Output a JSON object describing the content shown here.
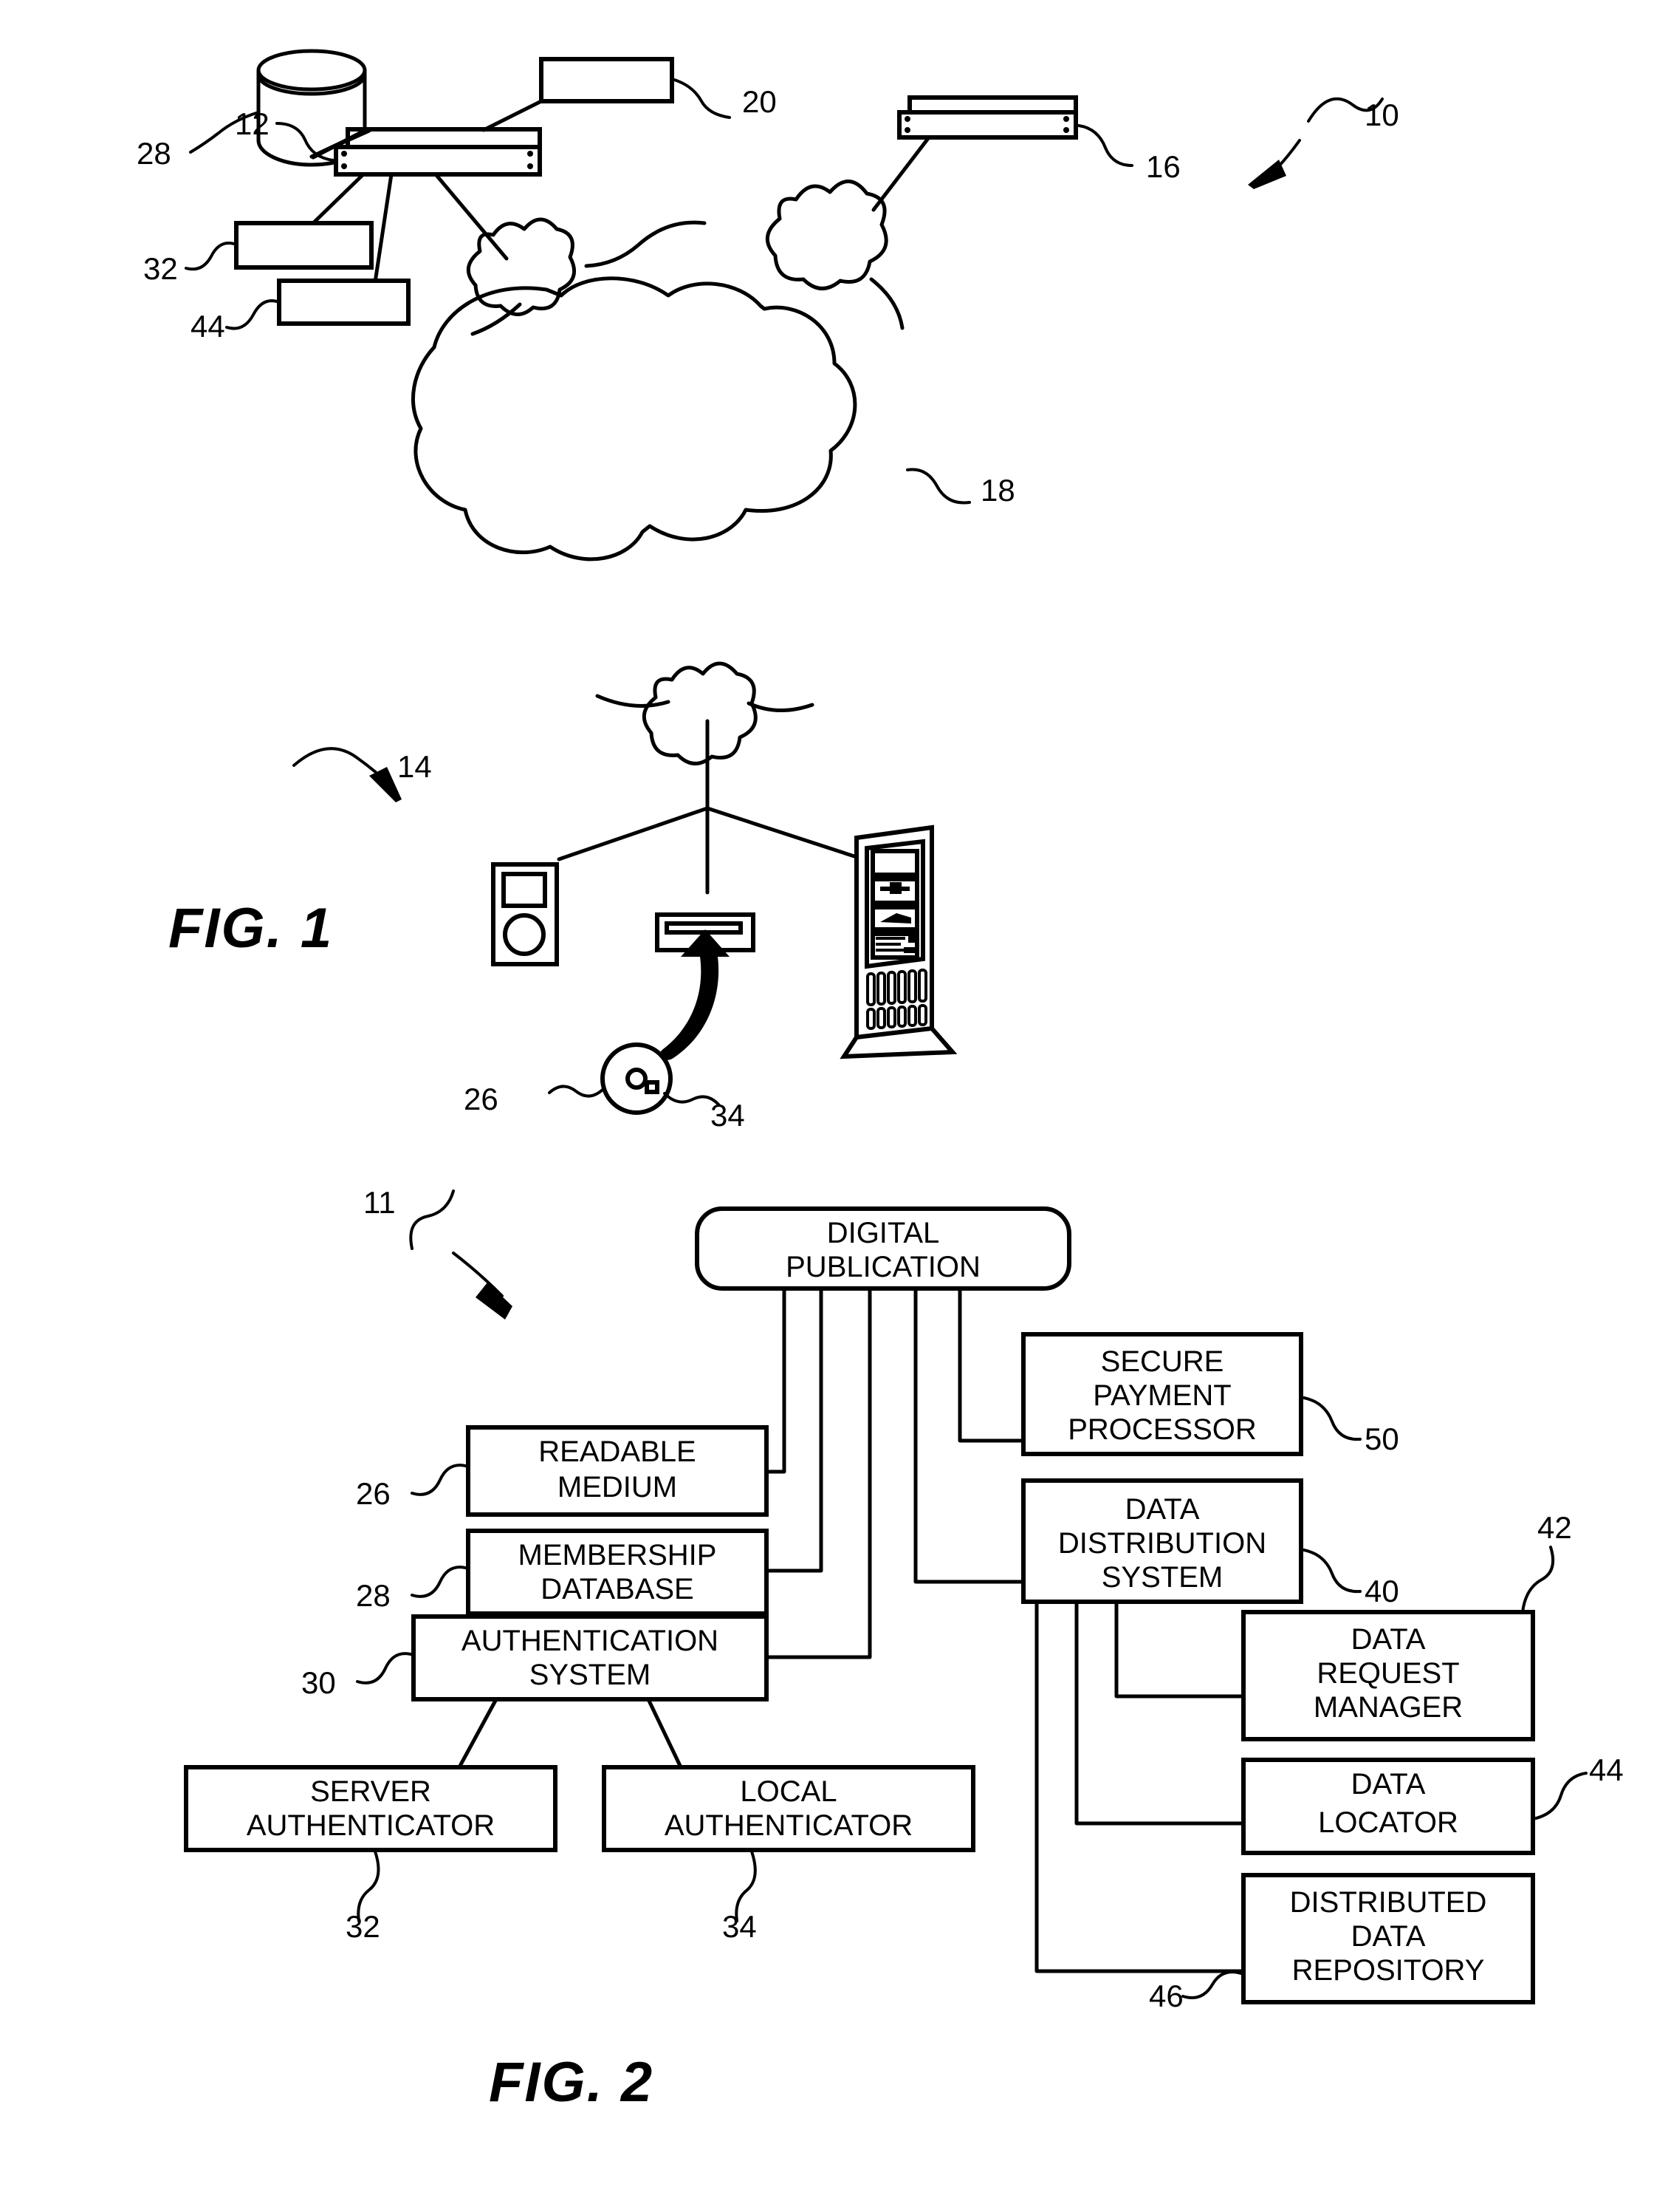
{
  "figures": [
    {
      "id": "fig1",
      "label": "FIG. 1",
      "overall_ref": "10",
      "reference_numbers": [
        {
          "id": "r28",
          "text": "28"
        },
        {
          "id": "r20",
          "text": "20"
        },
        {
          "id": "r12",
          "text": "12"
        },
        {
          "id": "r16",
          "text": "16"
        },
        {
          "id": "r10",
          "text": "10"
        },
        {
          "id": "r32",
          "text": "32"
        },
        {
          "id": "r18",
          "text": "18"
        },
        {
          "id": "r44",
          "text": "44"
        },
        {
          "id": "r14",
          "text": "14"
        },
        {
          "id": "r26",
          "text": "26"
        },
        {
          "id": "r34",
          "text": "34"
        }
      ],
      "components": [
        {
          "name": "database-cylinder",
          "ref": "28"
        },
        {
          "name": "blank-box-20",
          "ref": "20"
        },
        {
          "name": "server-rack-12",
          "ref": "12"
        },
        {
          "name": "server-rack-16",
          "ref": "16"
        },
        {
          "name": "blank-box-32",
          "ref": "32"
        },
        {
          "name": "blank-box-44",
          "ref": "44"
        },
        {
          "name": "network-cloud-18",
          "ref": "18"
        },
        {
          "name": "client-group-14",
          "ref": "14"
        },
        {
          "name": "optical-disc-26",
          "ref": "26"
        },
        {
          "name": "disc-drive-34",
          "ref": "34"
        },
        {
          "name": "handheld-device",
          "ref": ""
        },
        {
          "name": "tower-computer",
          "ref": ""
        }
      ]
    },
    {
      "id": "fig2",
      "label": "FIG. 2",
      "overall_ref": "11",
      "boxes": [
        {
          "id": "digital-publication",
          "lines": [
            "DIGITAL",
            "PUBLICATION"
          ],
          "ref": ""
        },
        {
          "id": "readable-medium",
          "lines": [
            "READABLE",
            "MEDIUM"
          ],
          "ref": "26"
        },
        {
          "id": "membership-database",
          "lines": [
            "MEMBERSHIP",
            "DATABASE"
          ],
          "ref": "28"
        },
        {
          "id": "authentication-system",
          "lines": [
            "AUTHENTICATION",
            "SYSTEM"
          ],
          "ref": "30"
        },
        {
          "id": "server-authenticator",
          "lines": [
            "SERVER",
            "AUTHENTICATOR"
          ],
          "ref": "32"
        },
        {
          "id": "local-authenticator",
          "lines": [
            "LOCAL",
            "AUTHENTICATOR"
          ],
          "ref": "34"
        },
        {
          "id": "secure-payment-processor",
          "lines": [
            "SECURE",
            "PAYMENT",
            "PROCESSOR"
          ],
          "ref": "50"
        },
        {
          "id": "data-distribution-system",
          "lines": [
            "DATA",
            "DISTRIBUTION",
            "SYSTEM"
          ],
          "ref": "40"
        },
        {
          "id": "data-request-manager",
          "lines": [
            "DATA",
            "REQUEST",
            "MANAGER"
          ],
          "ref": "42"
        },
        {
          "id": "data-locator",
          "lines": [
            "DATA",
            "LOCATOR"
          ],
          "ref": "44"
        },
        {
          "id": "distributed-data-repository",
          "lines": [
            "DISTRIBUTED",
            "DATA",
            "REPOSITORY"
          ],
          "ref": "46"
        }
      ],
      "reference_numbers": [
        {
          "id": "f2r11",
          "text": "11"
        },
        {
          "id": "f2r26",
          "text": "26"
        },
        {
          "id": "f2r28",
          "text": "28"
        },
        {
          "id": "f2r30",
          "text": "30"
        },
        {
          "id": "f2r32",
          "text": "32"
        },
        {
          "id": "f2r34",
          "text": "34"
        },
        {
          "id": "f2r50",
          "text": "50"
        },
        {
          "id": "f2r40",
          "text": "40"
        },
        {
          "id": "f2r42",
          "text": "42"
        },
        {
          "id": "f2r44",
          "text": "44"
        },
        {
          "id": "f2r46",
          "text": "46"
        }
      ]
    }
  ],
  "text": {
    "fig1_label": "FIG. 1",
    "fig2_label": "FIG. 2",
    "digital_publication_l1": "DIGITAL",
    "digital_publication_l2": "PUBLICATION",
    "readable_medium_l1": "READABLE",
    "readable_medium_l2": "MEDIUM",
    "membership_database_l1": "MEMBERSHIP",
    "membership_database_l2": "DATABASE",
    "authentication_system_l1": "AUTHENTICATION",
    "authentication_system_l2": "SYSTEM",
    "server_authenticator_l1": "SERVER",
    "server_authenticator_l2": "AUTHENTICATOR",
    "local_authenticator_l1": "LOCAL",
    "local_authenticator_l2": "AUTHENTICATOR",
    "secure_payment_l1": "SECURE",
    "secure_payment_l2": "PAYMENT",
    "secure_payment_l3": "PROCESSOR",
    "data_distribution_l1": "DATA",
    "data_distribution_l2": "DISTRIBUTION",
    "data_distribution_l3": "SYSTEM",
    "data_request_l1": "DATA",
    "data_request_l2": "REQUEST",
    "data_request_l3": "MANAGER",
    "data_locator_l1": "DATA",
    "data_locator_l2": "LOCATOR",
    "distributed_repo_l1": "DISTRIBUTED",
    "distributed_repo_l2": "DATA",
    "distributed_repo_l3": "REPOSITORY",
    "n10": "10",
    "n11": "11",
    "n12": "12",
    "n14": "14",
    "n16": "16",
    "n18": "18",
    "n20": "20",
    "n26": "26",
    "n28": "28",
    "n30": "30",
    "n32": "32",
    "n34": "34",
    "n40": "40",
    "n42": "42",
    "n44": "44",
    "n46": "46",
    "n50": "50",
    "f1_n26": "26",
    "f1_n28": "28",
    "f1_n32": "32",
    "f1_n34": "34",
    "f1_n44": "44"
  },
  "colors": {
    "ink": "#000000",
    "paper": "#ffffff"
  }
}
